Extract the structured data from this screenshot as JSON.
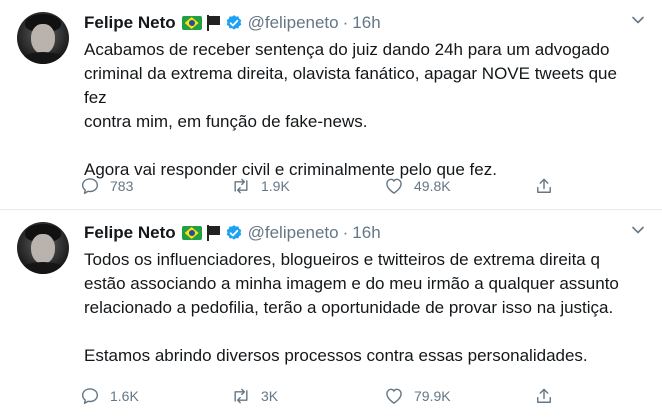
{
  "tweets": [
    {
      "author_name": "Felipe Neto",
      "handle": "@felipeneto",
      "separator": "·",
      "time": "16h",
      "text": "Acabamos de receber sentença do juiz dando 24h para um advogado\ncriminal da extrema direita, olavista fanático, apagar NOVE tweets que fez\ncontra mim, em função de fake-news.\n\nAgora vai responder civil e criminalmente pelo que fez.",
      "replies": "783",
      "retweets": "1.9K",
      "likes": "49.8K"
    },
    {
      "author_name": "Felipe Neto",
      "handle": "@felipeneto",
      "separator": "·",
      "time": "16h",
      "text": "Todos os influenciadores, blogueiros e twitteiros de extrema direita q\nestão associando a minha imagem e do meu irmão a qualquer assunto\nrelacionado a pedofilia, terão a oportunidade de provar isso na justiça.\n\nEstamos abrindo diversos processos contra essas personalidades.",
      "replies": "1.6K",
      "retweets": "3K",
      "likes": "79.9K"
    }
  ],
  "icons": {
    "verified": "verified-badge-icon",
    "reply": "speech-bubble-icon",
    "retweet": "retweet-arrows-icon",
    "like": "heart-icon",
    "share": "upload-arrow-icon",
    "menu": "chevron-down-icon"
  },
  "colors": {
    "text": "#14171a",
    "muted": "#657786",
    "verified": "#1da1f2",
    "divider": "#e6ecf0"
  }
}
